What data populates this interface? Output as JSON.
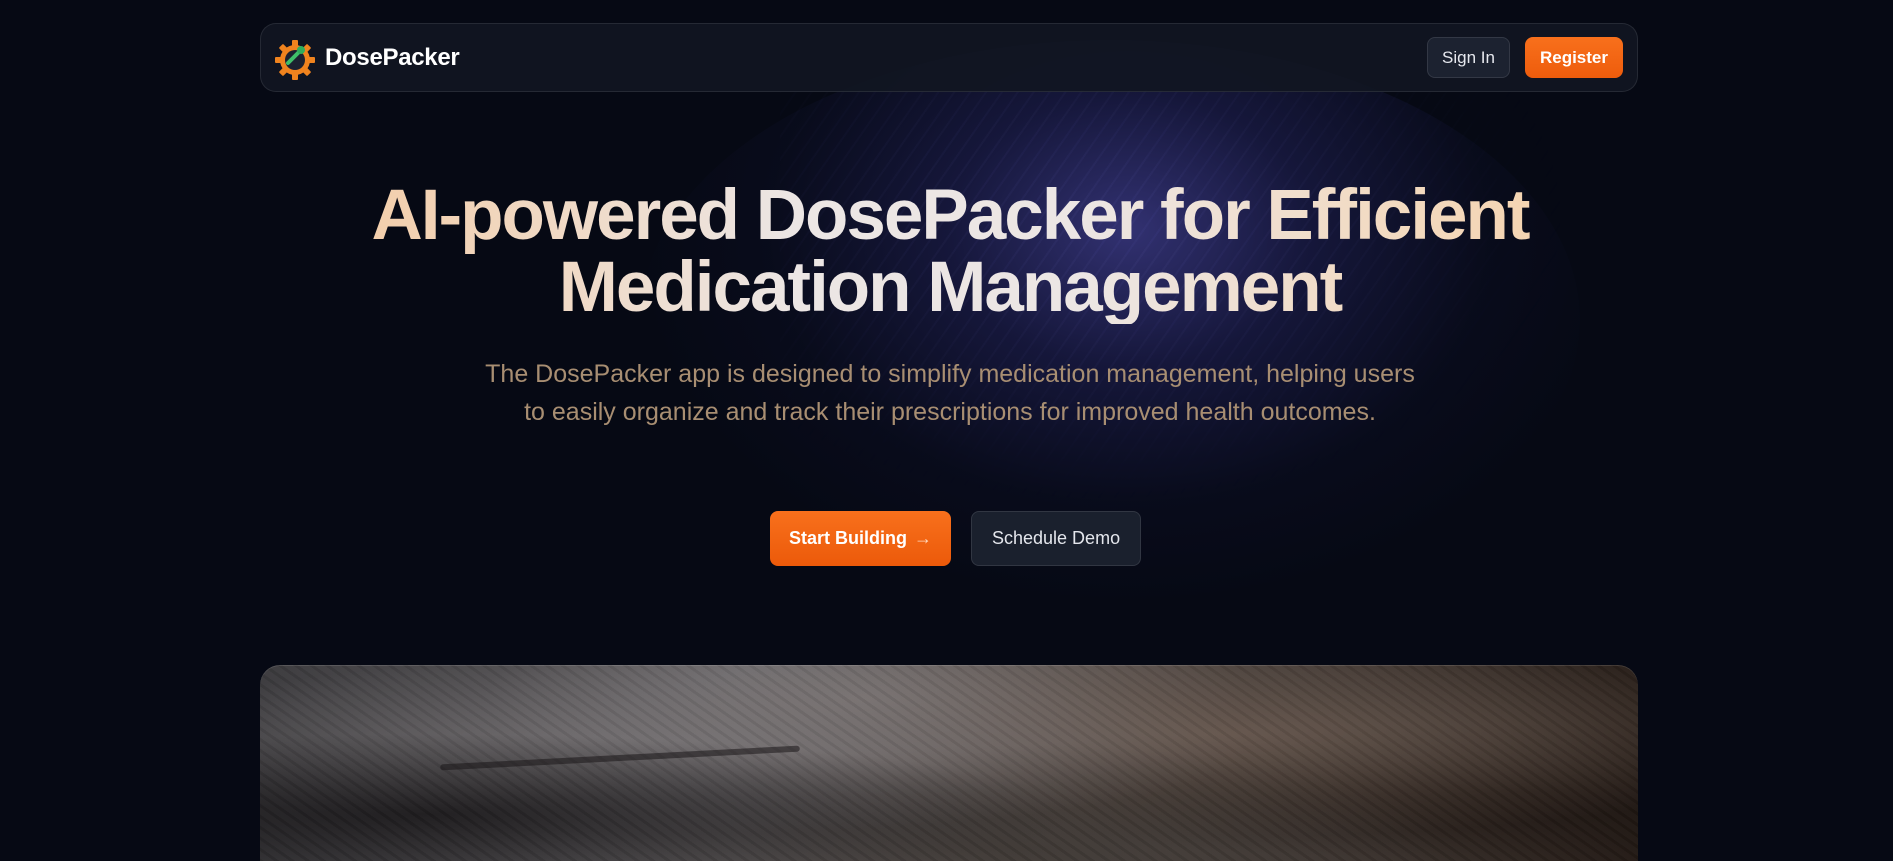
{
  "brand": {
    "name": "DosePacker",
    "logo_icon": "gear-pill-logo-icon"
  },
  "nav": {
    "sign_in_label": "Sign In",
    "register_label": "Register"
  },
  "hero": {
    "title_line1": "AI-powered DosePacker for Efficient",
    "title_line2": "Medication Management",
    "subtitle": "The DosePacker app is designed to simplify medication management, helping users to easily organize and track their prescriptions for improved health outcomes.",
    "primary_cta_label": "Start Building",
    "primary_cta_arrow": "→",
    "primary_cta_icon": "arrow-right-icon",
    "secondary_cta_label": "Schedule Demo"
  },
  "colors": {
    "background": "#060914",
    "accent_orange": "#f26510",
    "subtitle_text": "#a88e72",
    "title_gradient_start": "#f4cba3",
    "title_gradient_mid": "#ece6e4"
  }
}
